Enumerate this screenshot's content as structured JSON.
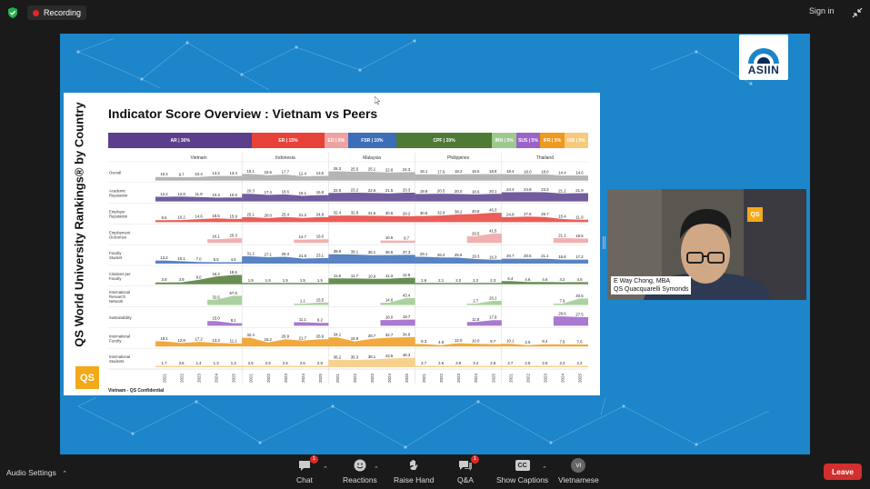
{
  "topbar": {
    "recording_label": "Recording",
    "signin_label": "Sign in"
  },
  "slide": {
    "vertical_title": "QS World University Rankings® by Country",
    "title": "Indicator Score Overview : Vietnam vs Peers",
    "logo_text": "QS",
    "footer": "Vietnam - QS Confidential",
    "partner_logo": "ASIIN",
    "legend": [
      {
        "label": "AR | 30%",
        "weight": 30,
        "color": "#5b3f8c"
      },
      {
        "label": "ER | 15%",
        "weight": 15,
        "color": "#e8413a"
      },
      {
        "label": "EO | 5%",
        "weight": 5,
        "color": "#f0a2a2"
      },
      {
        "label": "FSR | 10%",
        "weight": 10,
        "color": "#3c6db8"
      },
      {
        "label": "CPF | 20%",
        "weight": 20,
        "color": "#4e7a36"
      },
      {
        "label": "IRN | 5%",
        "weight": 5,
        "color": "#9dc98f"
      },
      {
        "label": "SUS | 5%",
        "weight": 5,
        "color": "#9a63c7"
      },
      {
        "label": "IFR | 5%",
        "weight": 5,
        "color": "#ee9a1c"
      },
      {
        "label": "ISR | 5%",
        "weight": 5,
        "color": "#f7c97a"
      }
    ],
    "countries": [
      "Vietnam",
      "Indonesia",
      "Malaysia",
      "Philippines",
      "Thailand"
    ],
    "years": [
      "2021",
      "2022",
      "2023",
      "2024",
      "2025"
    ],
    "rows": [
      {
        "label": "Overall",
        "color": "#a8a8a8",
        "values": [
          [
            10.4,
            9.7,
            10.4,
            13.2,
            13.4
          ],
          [
            19.1,
            15.6,
            17.7,
            12.4,
            13.6
          ],
          [
            26.3,
            25.5,
            25.1,
            22.8,
            24.3
          ],
          [
            18.1,
            17.6,
            18.2,
            18.6,
            18.8
          ],
          [
            18.4,
            18.0,
            18.0,
            14.4,
            14.6
          ]
        ]
      },
      {
        "label": "Academic Reputation",
        "color": "#5b3f8c",
        "values": [
          [
            12.2,
            12.8,
            11.8,
            10.3,
            10.5
          ],
          [
            20.3,
            17.4,
            18.6,
            15.1,
            16.8
          ],
          [
            22.5,
            23.2,
            22.6,
            21.5,
            23.3
          ],
          [
            19.8,
            20.5,
            20.0,
            18.6,
            20.1
          ],
          [
            24.4,
            24.8,
            24.3,
            21.2,
            21.9
          ]
        ]
      },
      {
        "label": "Employer Reputation",
        "color": "#e8413a",
        "values": [
          [
            9.6,
            10.2,
            14.6,
            18.5,
            15.9
          ],
          [
            25.1,
            20.0,
            25.4,
            21.2,
            24.8
          ],
          [
            32.4,
            32.8,
            31.6,
            30.6,
            29.2
          ],
          [
            30.5,
            32.9,
            38.2,
            40.8,
            46.3
          ],
          [
            24.8,
            27.5,
            25.7,
            15.4,
            11.9
          ]
        ]
      },
      {
        "label": "Employment Outcomes",
        "color": "#f0a2a2",
        "values": [
          [
            null,
            null,
            null,
            16.1,
            20.3
          ],
          [
            null,
            null,
            null,
            14.7,
            16.0
          ],
          [
            null,
            null,
            null,
            10.6,
            9.7
          ],
          [
            null,
            null,
            null,
            29.5,
            41.5
          ],
          [
            null,
            null,
            null,
            21.1,
            19.5
          ]
        ]
      },
      {
        "label": "Faculty Student",
        "color": "#3c6db8",
        "values": [
          [
            13.2,
            10.1,
            7.0,
            5.5,
            4.6
          ],
          [
            31.2,
            27.1,
            29.3,
            21.6,
            23.1
          ],
          [
            39.9,
            39.1,
            36.1,
            36.5,
            37.3
          ],
          [
            29.1,
            26.2,
            25.6,
            19.3,
            16.3
          ],
          [
            20.7,
            20.5,
            21.1,
            16.8,
            17.2
          ]
        ]
      },
      {
        "label": "Citations per Faculty",
        "color": "#4e7a36",
        "values": [
          [
            3.8,
            3.9,
            9.0,
            15.4,
            18.6
          ],
          [
            1.9,
            1.5,
            1.5,
            1.5,
            1.5
          ],
          [
            11.8,
            11.7,
            10.9,
            11.3,
            12.9
          ],
          [
            2.6,
            2.1,
            2.2,
            2.2,
            2.3
          ],
          [
            6.4,
            4.6,
            4.6,
            4.2,
            4.5
          ]
        ]
      },
      {
        "label": "International Research Network",
        "color": "#9dc98f",
        "values": [
          [
            null,
            null,
            null,
            32.6,
            57.6
          ],
          [
            null,
            null,
            null,
            1.1,
            15.5
          ],
          [
            null,
            null,
            null,
            14.6,
            43.4
          ],
          [
            null,
            null,
            null,
            2.7,
            26.1
          ],
          [
            null,
            null,
            null,
            7.9,
            40.5
          ]
        ]
      },
      {
        "label": "Sustainability",
        "color": "#9a63c7",
        "values": [
          [
            null,
            null,
            null,
            15.0,
            8.1
          ],
          [
            null,
            null,
            null,
            11.1,
            9.2
          ],
          [
            null,
            null,
            null,
            18.0,
            19.7
          ],
          [
            null,
            null,
            null,
            11.8,
            17.9
          ],
          [
            null,
            null,
            null,
            29.6,
            27.5
          ]
        ]
      },
      {
        "label": "International Faculty",
        "color": "#ee9a1c",
        "values": [
          [
            19.1,
            12.8,
            17.2,
            13.3,
            11.1
          ],
          [
            32.4,
            15.2,
            26.9,
            21.7,
            26.9
          ],
          [
            34.1,
            18.9,
            28.7,
            32.7,
            34.6
          ],
          [
            9.3,
            4.9,
            12.0,
            10.0,
            8.7
          ],
          [
            10.1,
            2.6,
            8.4,
            7.9,
            7.6
          ]
        ]
      },
      {
        "label": "International Students",
        "color": "#f7c97a",
        "values": [
          [
            1.7,
            3.6,
            1.4,
            1.3,
            1.3
          ],
          [
            2.5,
            2.5,
            2.5,
            2.6,
            2.8
          ],
          [
            36.2,
            35.3,
            38.1,
            43.5,
            46.3
          ],
          [
            3.7,
            2.6,
            3.9,
            3.4,
            2.8
          ],
          [
            2.7,
            2.8,
            2.6,
            2.3,
            2.2
          ]
        ]
      }
    ]
  },
  "video": {
    "participant_name": "E Way Chong, MBA",
    "participant_org": "QS Quacquarelli Symonds",
    "logo_text": "QS"
  },
  "toolbar": {
    "audio_settings": "Audio Settings",
    "chat": "Chat",
    "chat_badge": "1",
    "reactions": "Reactions",
    "raise_hand": "Raise Hand",
    "qa": "Q&A",
    "qa_badge": "1",
    "captions": "Show Captions",
    "captions_icon": "CC",
    "language": "Vietnamese",
    "language_icon": "VI",
    "leave": "Leave"
  }
}
